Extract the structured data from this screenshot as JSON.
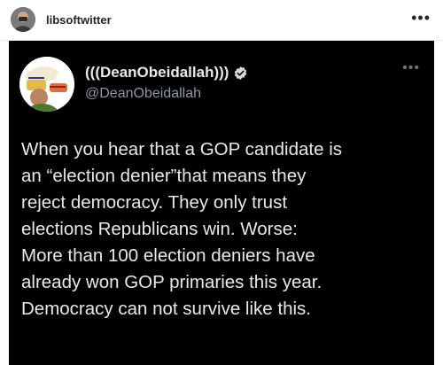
{
  "post": {
    "username": "libsoftwitter",
    "more_icon": "more-horizontal-icon"
  },
  "tweet": {
    "display_name": "(((DeanObeidallah)))",
    "handle": "@DeanObeidallah",
    "verified": true,
    "avatar_icon": "profile-avatar",
    "more_icon": "more-horizontal-icon",
    "text": "When you hear that a GOP candidate is\nan “election denier”that means they\nreject democracy. They only trust\nelections Republicans win. Worse:\nMore than 100 election deniers have\nalready won GOP primaries this year.\nDemocracy can not survive like this."
  },
  "colors": {
    "tweet_background": "#000000",
    "tweet_text": "#e7e9ea",
    "handle_text": "#8b98a5",
    "verified_badge": "#d9d9d9"
  }
}
